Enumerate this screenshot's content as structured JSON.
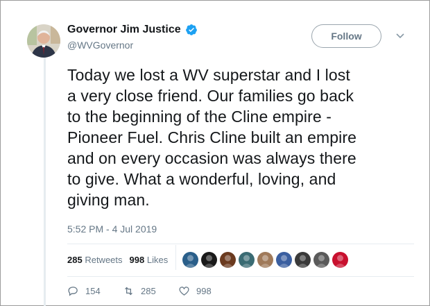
{
  "author": {
    "display_name": "Governor Jim Justice",
    "handle": "@WVGovernor",
    "verified": true
  },
  "follow_button": {
    "label": "Follow"
  },
  "tweet": {
    "text": "Today we lost a WV superstar and I lost\na very close friend. Our families go back\nto the beginning of the Cline empire -\nPioneer Fuel. Chris Cline built an empire\nand on every occasion was always there\nto give. What a wonderful, loving, and\ngiving man.",
    "timestamp": "5:52 PM - 4 Jul 2019"
  },
  "stats": {
    "retweets_count": "285",
    "retweets_label": "Retweets",
    "likes_count": "998",
    "likes_label": "Likes"
  },
  "liker_avatars": [
    {
      "name": "liker-avatar-1",
      "color": "#2a5f8a"
    },
    {
      "name": "liker-avatar-2",
      "color": "#1a1a1a"
    },
    {
      "name": "liker-avatar-3",
      "color": "#6b3a1f"
    },
    {
      "name": "liker-avatar-4",
      "color": "#3a6b73"
    },
    {
      "name": "liker-avatar-5",
      "color": "#a07a5a"
    },
    {
      "name": "liker-avatar-6",
      "color": "#3b5fa0"
    },
    {
      "name": "liker-avatar-7",
      "color": "#3a3a3a"
    },
    {
      "name": "liker-avatar-8",
      "color": "#5a5a5a"
    },
    {
      "name": "liker-avatar-9",
      "color": "#c8102e"
    }
  ],
  "actions": {
    "reply_count": "154",
    "retweet_count": "285",
    "like_count": "998"
  },
  "colors": {
    "verified_blue": "#1da1f2",
    "secondary_text": "#657786"
  }
}
